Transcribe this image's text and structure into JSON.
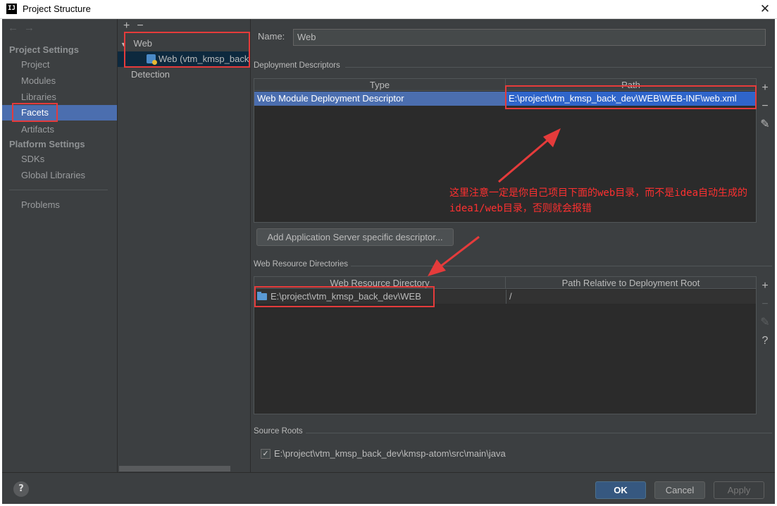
{
  "window": {
    "title": "Project Structure",
    "app_icon": "IJ"
  },
  "nav": {
    "project_settings": "Project Settings",
    "project_items": [
      "Project",
      "Modules",
      "Libraries",
      "Facets",
      "Artifacts"
    ],
    "platform_settings": "Platform Settings",
    "platform_items": [
      "SDKs",
      "Global Libraries"
    ],
    "problems": "Problems",
    "selected": "Facets"
  },
  "tree": {
    "add": "+",
    "remove": "−",
    "web_group": "Web",
    "web_facet": "Web (vtm_kmsp_back",
    "detection": "Detection"
  },
  "facet": {
    "name_label": "Name:",
    "name_value": "Web",
    "deployment_descriptors": {
      "title": "Deployment Descriptors",
      "columns": [
        "Type",
        "Path"
      ],
      "rows": [
        {
          "type": "Web Module Deployment Descriptor",
          "path": "E:\\project\\vtm_kmsp_back_dev\\WEB\\WEB-INF\\web.xml"
        }
      ]
    },
    "add_server_descriptor_button": "Add Application Server specific descriptor...",
    "web_resource_directories": {
      "title": "Web Resource Directories",
      "columns": [
        "Web Resource Directory",
        "Path Relative to Deployment Root"
      ],
      "rows": [
        {
          "directory": "E:\\project\\vtm_kmsp_back_dev\\WEB",
          "relative": "/"
        }
      ]
    },
    "source_roots": {
      "title": "Source Roots",
      "items": [
        {
          "checked": true,
          "path": "E:\\project\\vtm_kmsp_back_dev\\kmsp-atom\\src\\main\\java"
        }
      ]
    }
  },
  "footer": {
    "ok": "OK",
    "cancel": "Cancel",
    "apply": "Apply",
    "help": "?"
  },
  "annotation": {
    "text": "这里注意一定是你自己项目下面的web目录，而不是idea自动生成的idea1/web目录，否则就会报错",
    "color": "#ff3030"
  }
}
